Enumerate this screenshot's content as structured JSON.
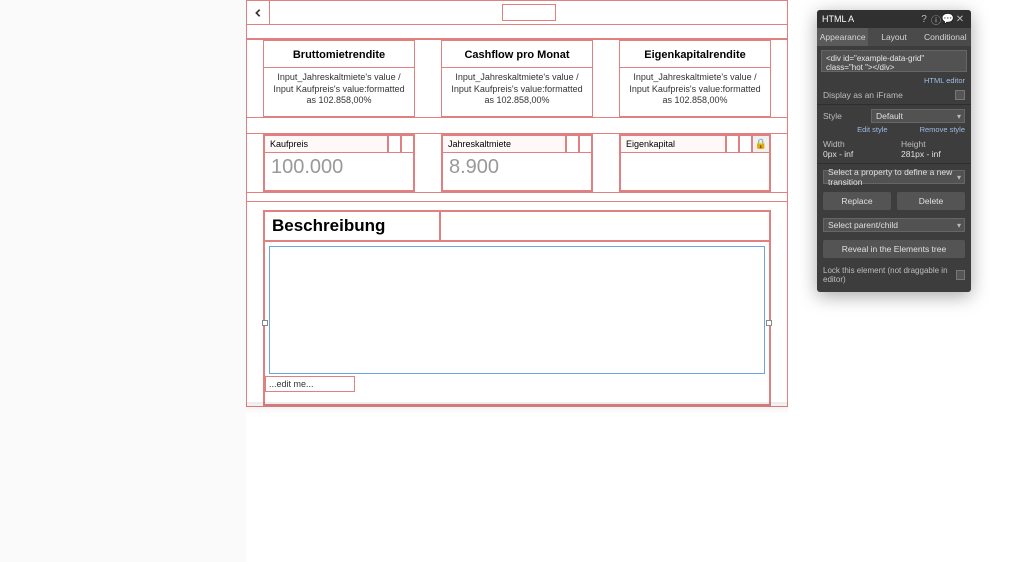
{
  "canvas": {
    "back_icon": "‹",
    "cards": [
      {
        "title": "Bruttomietrendite",
        "body": "Input_Jahreskaltmiete's value / Input Kaufpreis's value:formatted as 102.858,00%"
      },
      {
        "title": "Cashflow pro Monat",
        "body": "Input_Jahreskaltmiete's value / Input Kaufpreis's value:formatted as 102.858,00%"
      },
      {
        "title": "Eigenkapitalrendite",
        "body": "Input_Jahreskaltmiete's value / Input Kaufpreis's value:formatted as 102.858,00%"
      }
    ],
    "inputs": [
      {
        "label": "Kaufpreis",
        "value": "100.000",
        "locked": false
      },
      {
        "label": "Jahreskaltmiete",
        "value": "8.900",
        "locked": false
      },
      {
        "label": "Eigenkapital",
        "value": "",
        "locked": true
      }
    ],
    "section_title": "Beschreibung",
    "edit_placeholder": "...edit me..."
  },
  "panel": {
    "title": "HTML A",
    "tabs": {
      "t1": "Appearance",
      "t2": "Layout",
      "t3": "Conditional"
    },
    "code": "<div id=\"example-data-grid\" class=\"hot \"></div>",
    "html_editor_link": "HTML editor",
    "iframe_label": "Display as an iFrame",
    "style_label": "Style",
    "style_value": "Default",
    "edit_style": "Edit style",
    "remove_style": "Remove style",
    "width_label": "Width",
    "width_value": "0px - inf",
    "height_label": "Height",
    "height_value": "281px - inf",
    "transition_select": "Select a property to define a new transition",
    "replace_btn": "Replace",
    "delete_btn": "Delete",
    "select_parent": "Select parent/child",
    "reveal_btn": "Reveal in the Elements tree",
    "lock_label": "Lock this element (not draggable in editor)"
  }
}
